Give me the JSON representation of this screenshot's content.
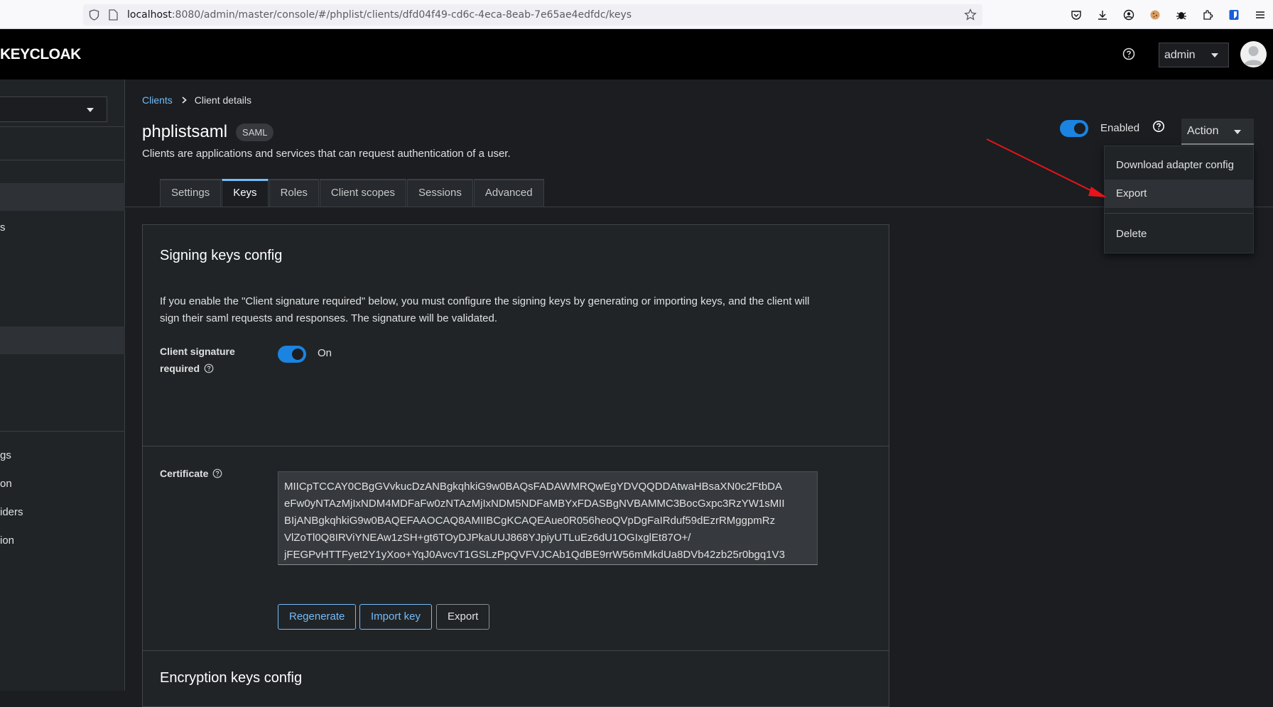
{
  "browser": {
    "url_host": "localhost",
    "url_rest": ":8080/admin/master/console/#/phplist/clients/dfd04f49-cd6c-4eca-8eab-7e65ae4edfdc/keys"
  },
  "header": {
    "logo_bold": "KEYCLOAK",
    "user": "admin"
  },
  "sidebar": {
    "partial_items": [
      "s",
      "gs",
      "on",
      "iders",
      "ion"
    ]
  },
  "breadcrumb": {
    "parent": "Clients",
    "current": "Client details"
  },
  "client": {
    "name": "phplistsaml",
    "protocol_badge": "SAML",
    "description": "Clients are applications and services that can request authentication of a user.",
    "enabled_label": "Enabled",
    "action_label": "Action"
  },
  "tabs": [
    {
      "label": "Settings"
    },
    {
      "label": "Keys"
    },
    {
      "label": "Roles"
    },
    {
      "label": "Client scopes"
    },
    {
      "label": "Sessions"
    },
    {
      "label": "Advanced"
    }
  ],
  "signing": {
    "title": "Signing keys config",
    "description": "If you enable the \"Client signature required\" below, you must configure the signing keys by generating or importing keys, and the client will sign their saml requests and responses. The signature will be validated.",
    "toggle_label_line1": "Client signature",
    "toggle_label_line2": "required",
    "toggle_state": "On",
    "certificate_label": "Certificate",
    "certificate_lines": [
      "MIICpTCCAY0CBgGVvkucDzANBgkqhkiG9w0BAQsFADAWMRQwEgYDVQQDDAtwaHBsaXN0c2FtbDA",
      "eFw0yNTAzMjIxNDM4MDFaFw0zNTAzMjIxNDM5NDFaMBYxFDASBgNVBAMMC3BocGxpc3RzYW1sMII",
      "BIjANBgkqhkiG9w0BAQEFAAOCAQ8AMIIBCgKCAQEAue0R056heoQVpDgFaIRduf59dEzrRMggpmRz",
      "VlZoTl0Q8IRViYNEAw1zSH+gt6TOyDJPkaUUJ868YJpiyUTLuEz6dU1OGIxglEt87O+/",
      "jFEGPvHTTFyet2Y1yXoo+YqJ0AvcvT1GSLzPpQVFVJCAb1QdBE9rrW56mMkdUa8DVb42zb25r0bgq1V3"
    ],
    "buttons": {
      "regenerate": "Regenerate",
      "import_key": "Import key",
      "export": "Export"
    }
  },
  "encryption": {
    "title": "Encryption keys config"
  },
  "action_menu": {
    "items": [
      "Download adapter config",
      "Export",
      "Delete"
    ]
  }
}
